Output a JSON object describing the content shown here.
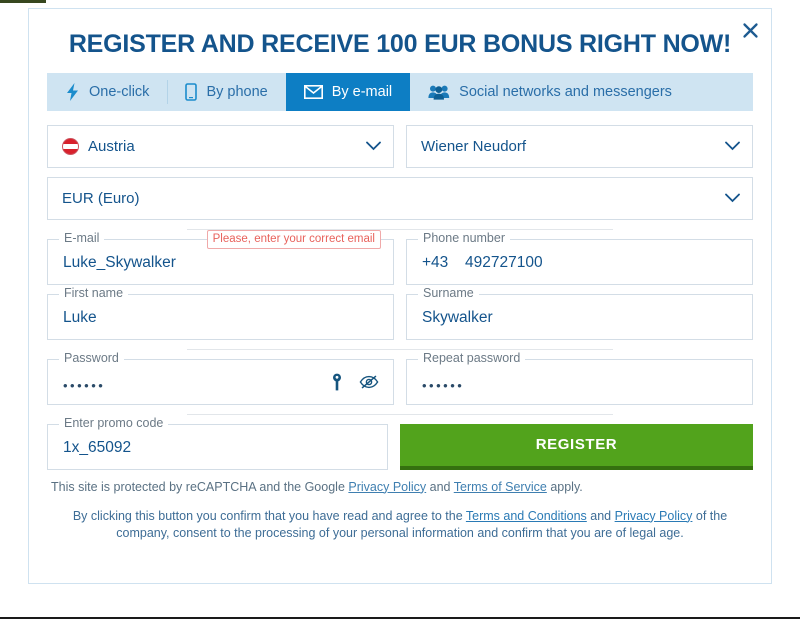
{
  "modal": {
    "title": "REGISTER AND RECEIVE 100 EUR BONUS RIGHT NOW!",
    "close_label": "×",
    "close_icon": "close-icon"
  },
  "tabs": [
    {
      "label": "One-click",
      "icon": "bolt-icon",
      "active": false
    },
    {
      "label": "By phone",
      "icon": "mobile-phone-icon",
      "active": false
    },
    {
      "label": "By e-mail",
      "icon": "envelope-icon",
      "active": true
    },
    {
      "label": "Social networks and messengers",
      "icon": "people-group-icon",
      "active": false
    }
  ],
  "selects": {
    "country": {
      "value": "Austria",
      "flag": "austria-flag-icon",
      "chevron": "chevron-down-icon"
    },
    "city": {
      "value": "Wiener Neudorf",
      "chevron": "chevron-down-icon"
    },
    "currency": {
      "value": "EUR (Euro)",
      "chevron": "chevron-down-icon"
    }
  },
  "fields": {
    "email": {
      "label": "E-mail",
      "value": "Luke_Skywalker",
      "error": "Please, enter your correct email"
    },
    "phone": {
      "label": "Phone number",
      "prefix": "+43",
      "value": "492727100"
    },
    "first_name": {
      "label": "First name",
      "value": "Luke"
    },
    "surname": {
      "label": "Surname",
      "value": "Skywalker"
    },
    "password": {
      "label": "Password",
      "value": "••••••",
      "key_icon": "key-icon",
      "eye_icon": "eye-slash-icon"
    },
    "repeat_password": {
      "label": "Repeat password",
      "value": "••••••"
    },
    "promo": {
      "label": "Enter promo code",
      "value": "1x_65092"
    }
  },
  "register_button": {
    "label": "REGISTER",
    "color": "#52a31c"
  },
  "legal": {
    "recaptcha_prefix": "This site is protected by reCAPTCHA and the Google ",
    "recaptcha_link1": "Privacy Policy",
    "recaptcha_mid": " and ",
    "recaptcha_link2": "Terms of Service",
    "recaptcha_suffix": " apply.",
    "confirm_prefix": "By clicking this button you confirm that you have read and agree to the ",
    "confirm_link1": "Terms and Conditions",
    "confirm_mid": " and ",
    "confirm_link2": "Privacy Policy",
    "confirm_suffix": " of the company, consent to the processing of your personal information and confirm that you are of legal age."
  },
  "colors": {
    "title": "#14548c",
    "tab_active_bg": "#0d7ec4",
    "tab_bar_bg": "#cfe4f2",
    "register_green": "#52a31c",
    "error_red": "#e8625c"
  }
}
